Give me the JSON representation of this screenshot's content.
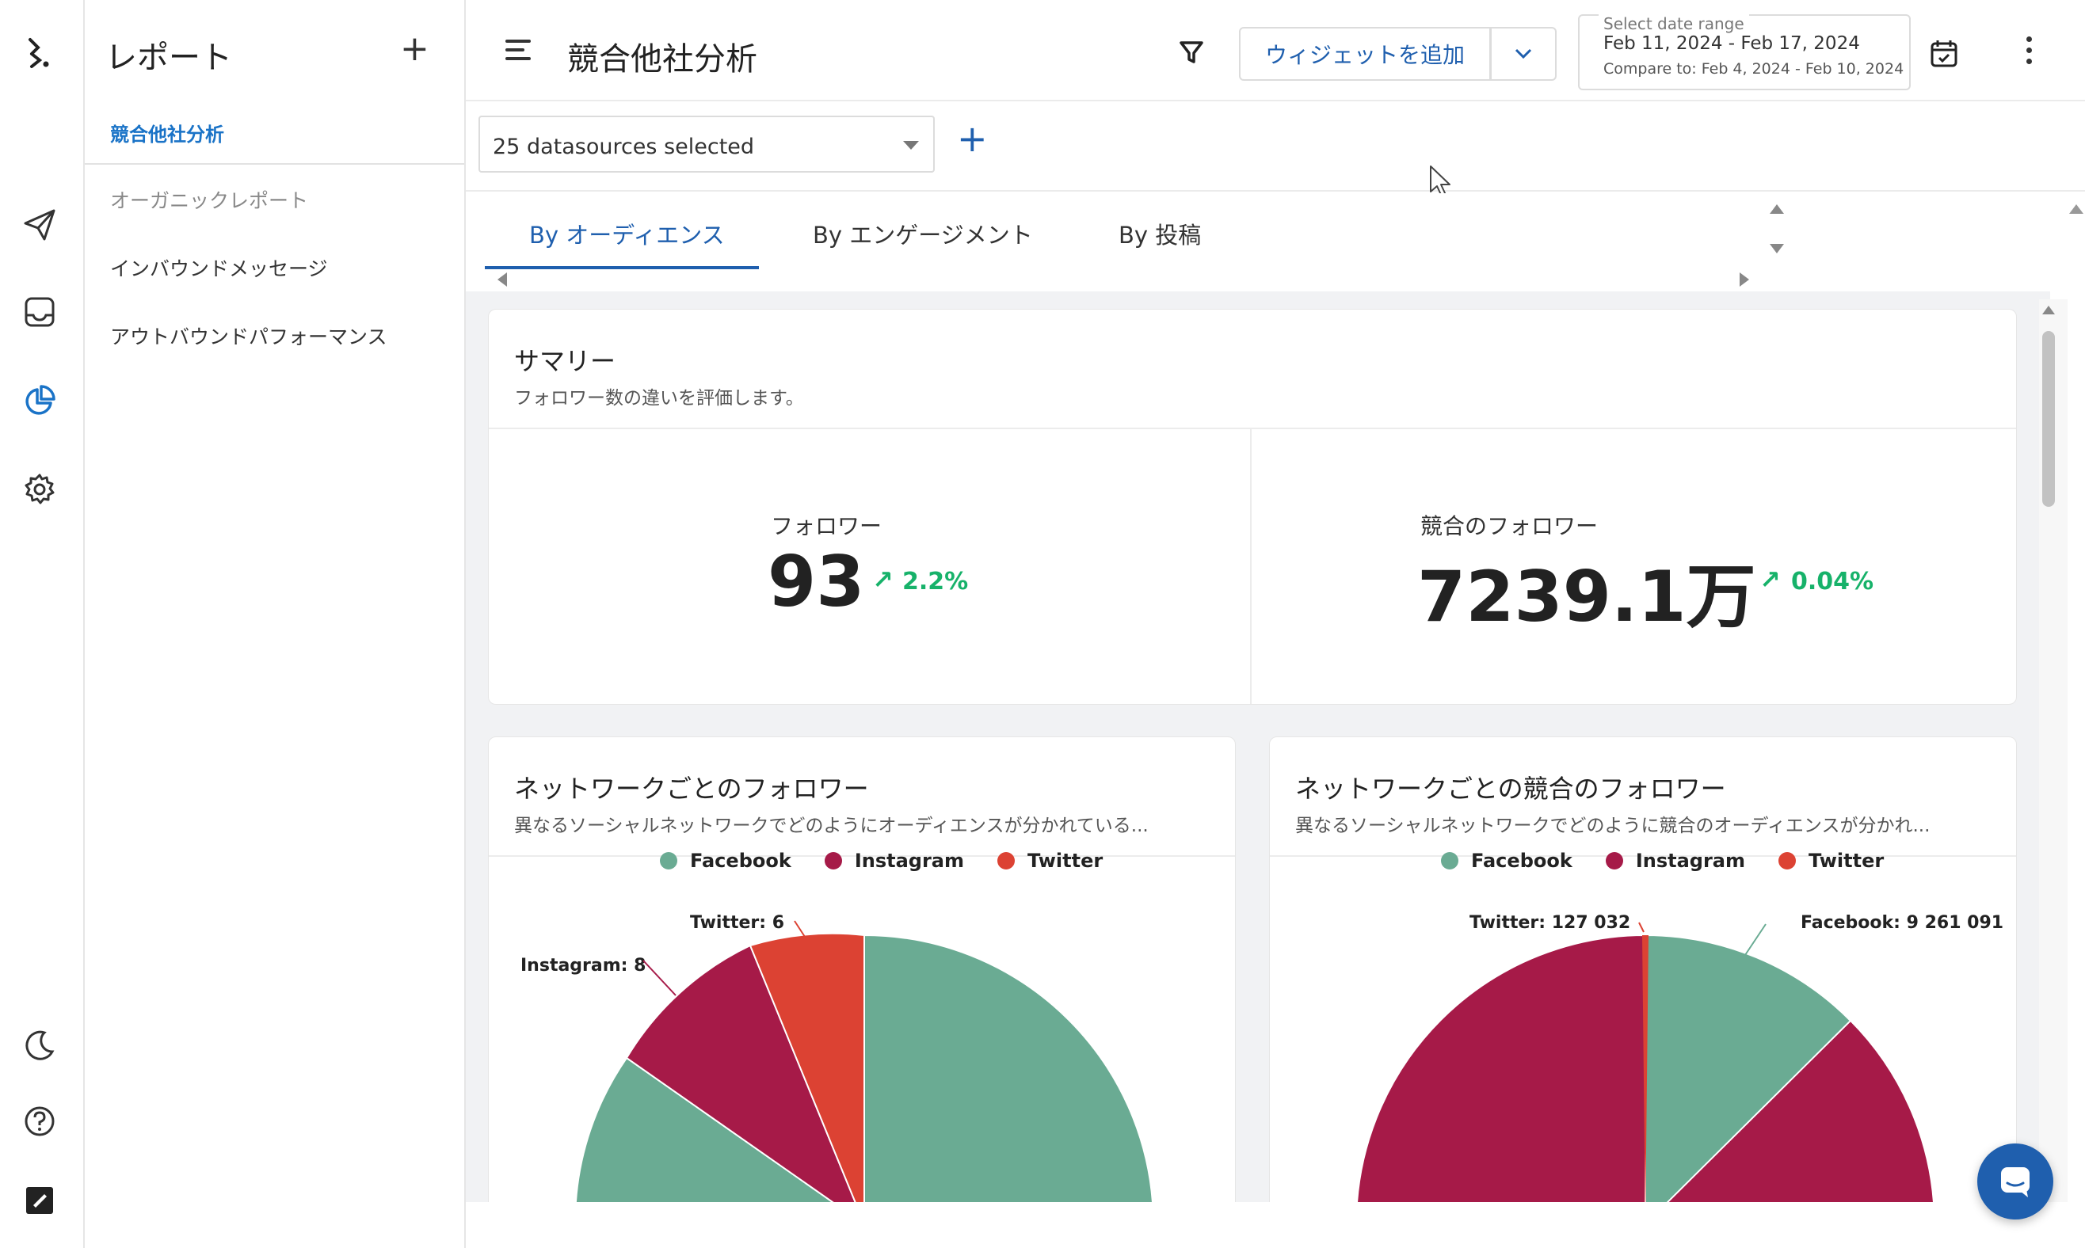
{
  "app": {
    "side_title": "レポート",
    "side_add": "+",
    "side_items": [
      {
        "label": "競合他社分析"
      },
      {
        "label": "オーガニックレポート"
      },
      {
        "label": "インバウンドメッセージ"
      },
      {
        "label": "アウトバウンドパフォーマンス"
      }
    ]
  },
  "header": {
    "title": "競合他社分析",
    "add_widget_label": "ウィジェットを追加",
    "date_range_label": "Select date range",
    "date_range": "Feb 11, 2024 - Feb 17, 2024",
    "compare": "Compare to: Feb 4, 2024 - Feb 10, 2024"
  },
  "datasources": {
    "selected": "25 datasources selected",
    "add": "+"
  },
  "tabs": [
    {
      "label": "By オーディエンス",
      "active": true
    },
    {
      "label": "By エンゲージメント",
      "active": false
    },
    {
      "label": "By 投稿",
      "active": false
    }
  ],
  "summary": {
    "title": "サマリー",
    "subtitle": "フォロワー数の違いを評価します。",
    "metrics": [
      {
        "label": "フォロワー",
        "value": "93",
        "arrow": "↗",
        "change": "2.2%"
      },
      {
        "label": "競合のフォロワー",
        "value": "7239.1万",
        "arrow": "↗",
        "change": "0.04%"
      }
    ]
  },
  "network_followers": {
    "title": "ネットワークごとのフォロワー",
    "subtitle": "異なるソーシャルネットワークでどのようにオーディエンスが分かれている...",
    "legend": [
      {
        "name": "Facebook",
        "color": "#6aab93"
      },
      {
        "name": "Instagram",
        "color": "#a61a48"
      },
      {
        "name": "Twitter",
        "color": "#dc4233"
      }
    ],
    "labels": {
      "twitter": "Twitter: 6",
      "instagram": "Instagram: 8"
    }
  },
  "competitor_network_followers": {
    "title": "ネットワークごとの競合のフォロワー",
    "subtitle": "異なるソーシャルネットワークでどのように競合のオーディエンスが分かれ...",
    "legend": [
      {
        "name": "Facebook",
        "color": "#6aab93"
      },
      {
        "name": "Instagram",
        "color": "#a61a48"
      },
      {
        "name": "Twitter",
        "color": "#dc4233"
      }
    ],
    "labels": {
      "twitter": "Twitter: 127 032",
      "facebook": "Facebook: 9 261 091"
    }
  },
  "chart_data": [
    {
      "type": "pie",
      "title": "ネットワークごとのフォロワー",
      "categories": [
        "Facebook",
        "Instagram",
        "Twitter"
      ],
      "values": [
        null,
        8,
        6
      ],
      "colors": [
        "#6aab93",
        "#a61a48",
        "#dc4233"
      ],
      "legend": "top"
    },
    {
      "type": "pie",
      "title": "ネットワークごとの競合のフォロワー",
      "categories": [
        "Facebook",
        "Instagram",
        "Twitter"
      ],
      "values": [
        9261091,
        null,
        127032
      ],
      "colors": [
        "#6aab93",
        "#a61a48",
        "#dc4233"
      ],
      "legend": "top"
    }
  ]
}
